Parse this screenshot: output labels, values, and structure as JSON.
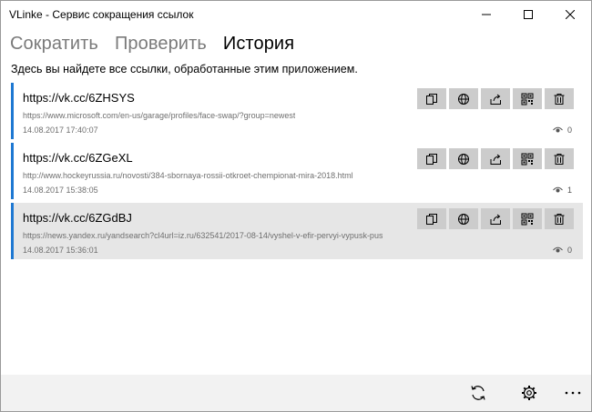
{
  "window": {
    "title": "VLinke - Сервис сокращения ссылок"
  },
  "tabs": [
    {
      "label": "Сократить",
      "active": false
    },
    {
      "label": "Проверить",
      "active": false
    },
    {
      "label": "История",
      "active": true
    }
  ],
  "subtitle": "Здесь вы найдете все ссылки, обработанные этим приложением.",
  "history": [
    {
      "short_url": "https://vk.cc/6ZHSYS",
      "long_url": "https://www.microsoft.com/en-us/garage/profiles/face-swap/?group=newest",
      "date": "14.08.2017 17:40:07",
      "views": "0"
    },
    {
      "short_url": "https://vk.cc/6ZGeXL",
      "long_url": "http://www.hockeyrussia.ru/novosti/384-sbornaya-rossii-otkroet-chempionat-mira-2018.html",
      "date": "14.08.2017 15:38:05",
      "views": "1"
    },
    {
      "short_url": "https://vk.cc/6ZGdBJ",
      "long_url": "https://news.yandex.ru/yandsearch?cl4url=iz.ru/632541/2017-08-14/vyshel-v-efir-pervyi-vypusk-pus",
      "date": "14.08.2017 15:36:01",
      "views": "0"
    }
  ],
  "item_actions": [
    "copy-icon",
    "globe-icon",
    "share-icon",
    "qr-code-icon",
    "trash-icon"
  ],
  "bottombar": {
    "buttons": [
      "refresh-icon",
      "gear-icon",
      "more-icon"
    ]
  },
  "colors": {
    "accent": "#1e78d2",
    "selected_bg": "#e6e6e6",
    "action_bg": "#cccccc"
  }
}
